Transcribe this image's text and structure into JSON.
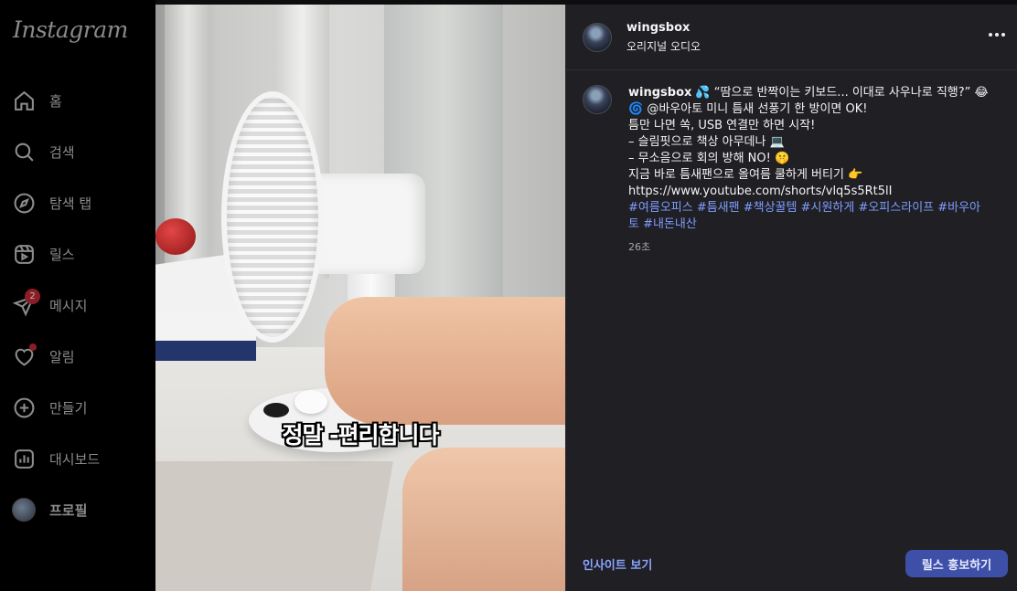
{
  "sidebar": {
    "logo": "Instagram",
    "items": [
      {
        "label": "홈",
        "icon": "home-icon"
      },
      {
        "label": "검색",
        "icon": "search-icon"
      },
      {
        "label": "탐색 탭",
        "icon": "compass-icon"
      },
      {
        "label": "릴스",
        "icon": "reels-icon"
      },
      {
        "label": "메시지",
        "icon": "send-icon",
        "badge": "2"
      },
      {
        "label": "알림",
        "icon": "heart-icon"
      },
      {
        "label": "만들기",
        "icon": "plus-square-icon"
      },
      {
        "label": "대시보드",
        "icon": "bar-chart-icon"
      },
      {
        "label": "프로필",
        "icon": "avatar"
      }
    ]
  },
  "media": {
    "caption": "정말 -편리합니다"
  },
  "post": {
    "author": "wingsbox",
    "audio": "오리지널 오디오",
    "comment": {
      "username": "wingsbox",
      "lines": [
        "💦 “땀으로 반짝이는 키보드... 이대로 사우나로 직행?” 😂",
        "🌀 @바우아토 미니 틈새 선풍기 한 방이면 OK!",
        "틈만 나면 쏙, USB 연결만 하면 시작!",
        "– 슬림핏으로 책상 아무데나 💻",
        "– 무소음으로 회의 방해 NO! 🤫",
        "지금 바로 틈새팬으로 올여름 쿨하게 버티기 👉",
        "https://www.youtube.com/shorts/vlq5s5Rt5lI"
      ],
      "hashtags_line1": "#여름오피스 #틈새팬 #책상꿀템 #시원하게 #오피스라이프 #바우아",
      "hashtags_line2": "토 #내돈내산"
    },
    "time": "26초",
    "insights_label": "인사이트 보기",
    "promote_label": "릴스 홍보하기"
  },
  "colors": {
    "panel_bg": "#1f1f24",
    "link": "#8aa4ff",
    "hashtag": "#7f9dff",
    "promote_bg": "#3e4fa8",
    "badge": "#8b1d25"
  }
}
